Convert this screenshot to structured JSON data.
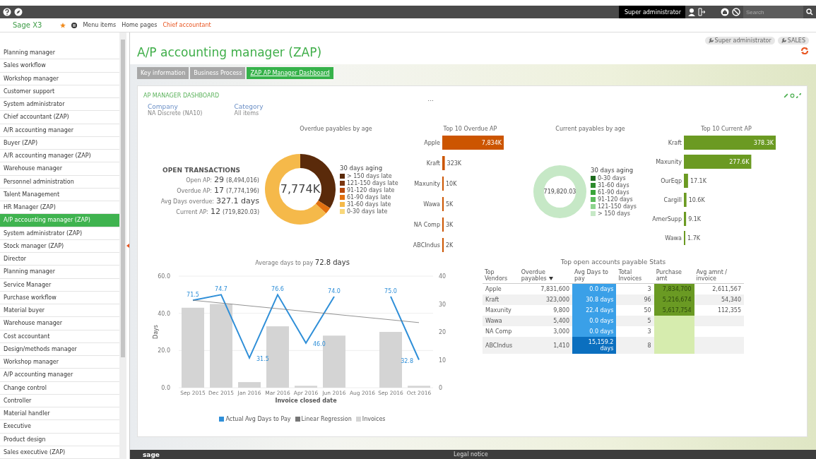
{
  "top_bar": {
    "user": "Super administrator",
    "search": {
      "placeholder": "Search"
    }
  },
  "nav_bar": {
    "logo": "Sage X3",
    "links": [
      {
        "label": "Menu items",
        "selected": false
      },
      {
        "label": "Home pages",
        "selected": false
      },
      {
        "label": "Chief accountant",
        "selected": true
      }
    ]
  },
  "sidebar": {
    "items": [
      {
        "label": "Planning manager",
        "selected": false
      },
      {
        "label": "Sales workflow",
        "selected": false
      },
      {
        "label": "Workshop manager",
        "selected": false
      },
      {
        "label": "Customer support",
        "selected": false
      },
      {
        "label": "System administrator",
        "selected": false
      },
      {
        "label": "Chief accountant (ZAP)",
        "selected": false
      },
      {
        "label": "A/R accounting manager",
        "selected": false
      },
      {
        "label": "Buyer (ZAP)",
        "selected": false
      },
      {
        "label": "A/R accounting manager (ZAP)",
        "selected": false
      },
      {
        "label": "Warehouse manager",
        "selected": false
      },
      {
        "label": "Personnel administration",
        "selected": false
      },
      {
        "label": "Talent Management",
        "selected": false
      },
      {
        "label": "HR Manager (ZAP)",
        "selected": false
      },
      {
        "label": "A/P accounting manager (ZAP)",
        "selected": true
      },
      {
        "label": "System administrator (ZAP)",
        "selected": false
      },
      {
        "label": "Stock manager (ZAP)",
        "selected": false
      },
      {
        "label": "Director",
        "selected": false
      },
      {
        "label": "Planning manager",
        "selected": false
      },
      {
        "label": "Service Manager",
        "selected": false
      },
      {
        "label": "Purchase workflow",
        "selected": false
      },
      {
        "label": "Material buyer",
        "selected": false
      },
      {
        "label": "Warehouse manager",
        "selected": false
      },
      {
        "label": "Cost accountant",
        "selected": false
      },
      {
        "label": "Design/methods manager",
        "selected": false
      },
      {
        "label": "Workshop manager",
        "selected": false
      },
      {
        "label": "A/P accounting manager",
        "selected": false
      },
      {
        "label": "Change control",
        "selected": false
      },
      {
        "label": "Controller",
        "selected": false
      },
      {
        "label": "Material handler",
        "selected": false
      },
      {
        "label": "Executive",
        "selected": false
      },
      {
        "label": "Product design",
        "selected": false
      },
      {
        "label": "Sales executive (ZAP)",
        "selected": false
      }
    ]
  },
  "page": {
    "title": "A/P accounting manager (ZAP)",
    "buttons": [
      "Super administrator",
      "SALES"
    ]
  },
  "tabs": [
    {
      "label": "Key information",
      "selected": false
    },
    {
      "label": "Business Process",
      "selected": false
    },
    {
      "label": "ZAP AP Manager Dashboard",
      "selected": true
    }
  ],
  "dashboard": {
    "title": "AP MANAGER DASHBOARD",
    "more": "...",
    "filters": [
      {
        "label": "Company",
        "value": "NA Discrete (NA10)"
      },
      {
        "label": "Category",
        "value": "All items"
      }
    ],
    "open_transactions": {
      "title": "OPEN TRANSACTIONS",
      "rows": [
        {
          "label": "Open AP:",
          "count": "29",
          "amount": "(8,494,016)"
        },
        {
          "label": "Overdue AP:",
          "count": "17",
          "amount": "(7,774,196)"
        },
        {
          "label": "Avg Days overdue:",
          "count": "327.1 days"
        },
        {
          "label": "Current AP:",
          "count": "12",
          "amount": "(719,820.03)"
        }
      ]
    },
    "overdue_by_age": {
      "title": "Overdue payables by age",
      "center": "7,774K",
      "legend_title": "30 days aging",
      "legend": [
        {
          "label": "> 150 days late",
          "color": "#5a2a0a"
        },
        {
          "label": "121-150 days late",
          "color": "#7a3510"
        },
        {
          "label": "91-120 days late",
          "color": "#b8480c"
        },
        {
          "label": "61-90 days late",
          "color": "#e2700f"
        },
        {
          "label": "31-60 days late",
          "color": "#f5b94a"
        },
        {
          "label": "0-30 days late",
          "color": "#f9d77a"
        }
      ]
    },
    "top_overdue": {
      "chart_data": {
        "type": "bar",
        "orientation": "horizontal",
        "title": "Top 10 Overdue AP",
        "categories": [
          "Apple",
          "Kraft",
          "Maxunity",
          "Wawa",
          "NA Comp",
          "ABCIndus"
        ],
        "series": [
          {
            "color": "#cc5500",
            "values": [
              7834,
              323,
              10,
              5,
              3,
              2
            ],
            "value_labels": [
              "7,834K",
              "323K",
              "10K",
              "5K",
              "3K",
              "2K"
            ]
          }
        ]
      }
    },
    "current_by_age": {
      "title": "Current payables by age",
      "center": "719,820.03",
      "legend_title": "30 days aging",
      "legend": [
        {
          "label": "0-30 days",
          "color": "#1e6b1e"
        },
        {
          "label": "31-60 days",
          "color": "#2e8b2e"
        },
        {
          "label": "61-90 days",
          "color": "#3aa53a"
        },
        {
          "label": "91-120 days",
          "color": "#5cbc5c"
        },
        {
          "label": "121-150 days",
          "color": "#8fd48f"
        },
        {
          "label": "> 150 days",
          "color": "#c6e8c6"
        }
      ]
    },
    "top_current": {
      "chart_data": {
        "type": "bar",
        "orientation": "horizontal",
        "title": "Top 10 Current AP",
        "categories": [
          "Kraft",
          "Maxunity",
          "OurEqp",
          "Cargill",
          "AmerSupp",
          "Wawa"
        ],
        "series": [
          {
            "color": "#6b9a22",
            "values": [
              378.3,
              277.6,
              17.1,
              10.6,
              9.1,
              1.7
            ],
            "value_labels": [
              "378.3K",
              "277.6K",
              "17.1K",
              "10.6K",
              "9.1K",
              "1.7K"
            ]
          }
        ]
      }
    },
    "avg_days": {
      "title": "Average days to pay **72.8 days**",
      "chart_data": {
        "type": "bar",
        "xlabel": "Invoice closed date",
        "ylabel": "Days",
        "categories": [
          "Sep 2015",
          "Dec 2015",
          "Jan 2016",
          "Mar 2016",
          "Apr 2016",
          "Jun 2016",
          "Aug 2016",
          "Sep 2016",
          "Oct 2016"
        ],
        "ylim": [
          0,
          60
        ],
        "yticks": [
          {
            "value": 0,
            "label": "0.0"
          },
          {
            "value": 20,
            "label": "20.0"
          },
          {
            "value": 40,
            "label": "40.0"
          },
          {
            "value": 60,
            "label": "60.0"
          }
        ],
        "y2lim": [
          0,
          40
        ],
        "y2ticks": [
          0,
          10,
          20,
          30,
          40
        ],
        "series": [
          {
            "name": "Actual Avg Days to Pay",
            "type": "line",
            "color": "#2f8fd8",
            "values": [
              47,
              50,
              16,
              50,
              24,
              49,
              null,
              49,
              15
            ]
          },
          {
            "name": "Linear Regression",
            "type": "line",
            "color": "#777777",
            "values": [
              47,
              45.5,
              44,
              42.5,
              41,
              39.5,
              38,
              36.5,
              35
            ]
          },
          {
            "name": "Invoices",
            "type": "bar",
            "color": "#d4d4d4",
            "values": [
              43,
              45,
              3,
              33,
              1,
              28,
              null,
              30,
              1
            ]
          }
        ],
        "annotations": [
          "71.5",
          "74.7",
          "31.5",
          "76.6",
          "46.0",
          "74.0",
          "75.0",
          "32.8"
        ]
      }
    },
    "stats_table": {
      "title": "Top open accounts payable Stats",
      "columns": [
        {
          "label": "Top Vendors",
          "sorted": false
        },
        {
          "label": "Overdue payables",
          "sorted": true
        },
        {
          "label": "Avg Days to pay",
          "sorted": false
        },
        {
          "label": "Total Invoices",
          "sorted": false
        },
        {
          "label": "Purchase amt",
          "sorted": false
        },
        {
          "label": "Avg amnt / invoice",
          "sorted": false
        }
      ],
      "rows": [
        {
          "cells": [
            {
              "text": "Apple"
            },
            {
              "text": "7,831,600"
            },
            {
              "text": "0.0 days",
              "color": "#3aa0e8"
            },
            {
              "text": "3"
            },
            {
              "text": "7,834,700",
              "color": "#6a9a23"
            },
            {
              "text": "2,611,567"
            }
          ]
        },
        {
          "cells": [
            {
              "text": "Kraft"
            },
            {
              "text": "323,000"
            },
            {
              "text": "30.8 days",
              "color": "#3aa0e8"
            },
            {
              "text": "96"
            },
            {
              "text": "5,216,674",
              "color": "#6a9a23"
            },
            {
              "text": "54,340"
            }
          ]
        },
        {
          "cells": [
            {
              "text": "Maxunity"
            },
            {
              "text": "9,800"
            },
            {
              "text": "22.4 days",
              "color": "#3aa0e8"
            },
            {
              "text": "50"
            },
            {
              "text": "5,617,754",
              "color": "#6a9a23"
            },
            {
              "text": "112,355"
            }
          ]
        },
        {
          "cells": [
            {
              "text": "Wawa"
            },
            {
              "text": "5,400"
            },
            {
              "text": "0.0 days",
              "color": "#3aa0e8"
            },
            {
              "text": "5"
            },
            {
              "color": "#d6ecae"
            },
            {}
          ]
        },
        {
          "cells": [
            {
              "text": "NA Comp"
            },
            {
              "text": "3,000"
            },
            {
              "text": "0.0 days",
              "color": "#3aa0e8"
            },
            {
              "text": "3"
            },
            {
              "color": "#d6ecae"
            },
            {}
          ]
        },
        {
          "cells": [
            {
              "text": "ABCIndus"
            },
            {
              "text": "1,410"
            },
            {
              "text": "15,159.2 days",
              "color": "#0b6fbf"
            },
            {
              "text": "8"
            },
            {
              "color": "#d6ecae"
            },
            {}
          ]
        }
      ]
    }
  },
  "footer": {
    "logo": "sage",
    "legal": "Legal notice"
  }
}
